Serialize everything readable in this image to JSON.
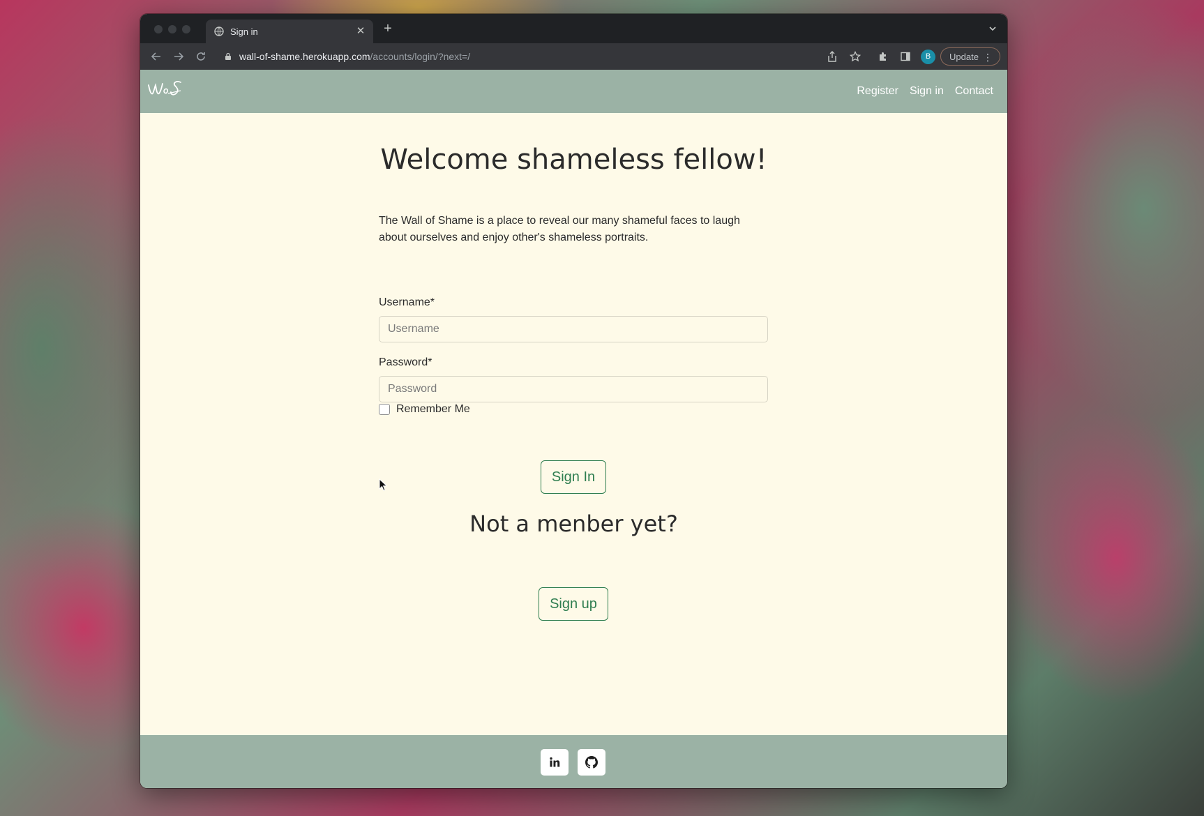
{
  "browser": {
    "tab_title": "Sign in",
    "url_host": "wall-of-shame.herokuapp.com",
    "url_path": "/accounts/login/?next=/",
    "profile_initial": "B",
    "update_label": "Update"
  },
  "navbar": {
    "brand": "WoS",
    "links": [
      "Register",
      "Sign in",
      "Contact"
    ]
  },
  "main": {
    "heading": "Welcome shameless fellow!",
    "intro": "The Wall of Shame is a place to reveal our many shameful faces to laugh about ourselves and enjoy other's shameless portraits.",
    "username_label": "Username*",
    "username_placeholder": "Username",
    "password_label": "Password*",
    "password_placeholder": "Password",
    "remember_label": "Remember Me",
    "signin_button": "Sign In",
    "not_member": "Not a menber yet?",
    "signup_button": "Sign up"
  },
  "footer": {
    "icons": [
      "linkedin-icon",
      "github-icon"
    ]
  },
  "colors": {
    "navbar_bg": "#9bb2a5",
    "page_bg": "#fefae8",
    "accent": "#2e7d4f"
  }
}
